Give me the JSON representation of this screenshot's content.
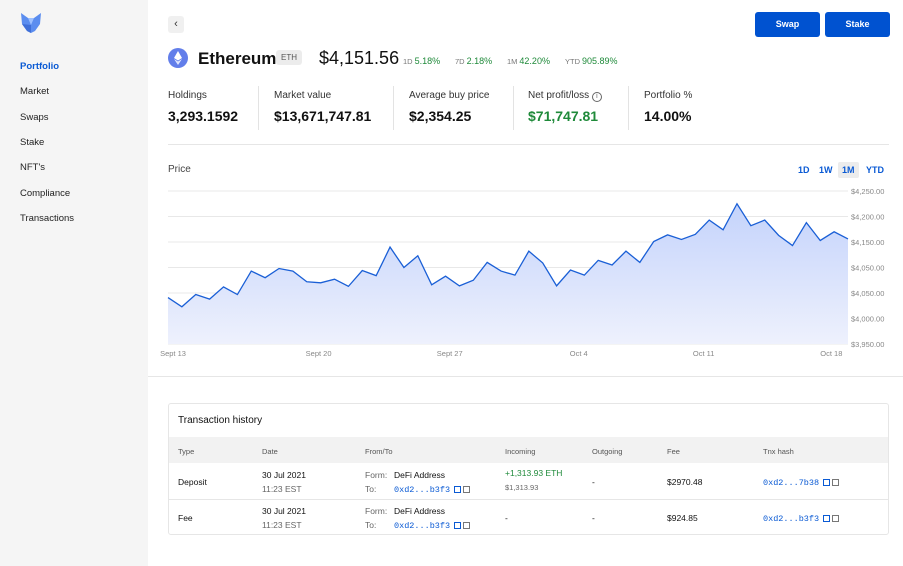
{
  "sidebar": {
    "items": [
      {
        "label": "Portfolio",
        "active": true
      },
      {
        "label": "Market"
      },
      {
        "label": "Swaps"
      },
      {
        "label": "Stake"
      },
      {
        "label": "NFT's"
      },
      {
        "label": "Compliance"
      },
      {
        "label": "Transactions"
      }
    ]
  },
  "header": {
    "back_icon": "‹",
    "swap": "Swap",
    "stake": "Stake"
  },
  "asset": {
    "name": "Ethereum",
    "ticker": "ETH",
    "price": "$4,151.56",
    "changes": [
      {
        "period": "1D",
        "value": "5.18%"
      },
      {
        "period": "7D",
        "value": "2.18%"
      },
      {
        "period": "1M",
        "value": "42.20%"
      },
      {
        "period": "YTD",
        "value": "905.89%"
      }
    ]
  },
  "stats": [
    {
      "label": "Holdings",
      "value": "3,293.1592"
    },
    {
      "label": "Market value",
      "value": "$13,671,747.81"
    },
    {
      "label": "Average buy price",
      "value": "$2,354.25"
    },
    {
      "label": "Net profit/loss",
      "value": "$71,747.81"
    },
    {
      "label": "Portfolio %",
      "value": "14.00%"
    }
  ],
  "colors": {
    "accent": "#0052d0",
    "positive": "#1f8a3a",
    "line": "#1a5fd6"
  },
  "chart_data": {
    "type": "area",
    "title": "Price",
    "ranges": [
      "1D",
      "1W",
      "1M",
      "YTD"
    ],
    "selected_range": "1M",
    "y_ticks": [
      "$4,250.00",
      "$4,200.00",
      "$4,150.00",
      "$4,050.00",
      "$4,050.00",
      "$4,000.00",
      "$3,950.00"
    ],
    "ylim": [
      3950,
      4250
    ],
    "x_labels": [
      {
        "label": "Sept 13",
        "at_index": 0
      },
      {
        "label": "Sept 20",
        "at_index": 10.85
      },
      {
        "label": "Sept 27",
        "at_index": 20.3
      },
      {
        "label": "Oct 4",
        "at_index": 29.6
      },
      {
        "label": "Oct 11",
        "at_index": 38.6
      },
      {
        "label": "Oct 18",
        "at_index": 47.8
      }
    ],
    "values": [
      4041,
      4023,
      4047,
      4038,
      4062,
      4047,
      4093,
      4080,
      4098,
      4093,
      4072,
      4070,
      4077,
      4063,
      4094,
      4084,
      4140,
      4100,
      4123,
      4066,
      4083,
      4064,
      4075,
      4110,
      4093,
      4085,
      4132,
      4109,
      4064,
      4095,
      4085,
      4114,
      4105,
      4132,
      4110,
      4151,
      4164,
      4155,
      4165,
      4193,
      4174,
      4225,
      4182,
      4193,
      4163,
      4143,
      4188,
      4153,
      4170,
      4156
    ]
  },
  "transactions": {
    "title": "Transaction history",
    "columns": [
      "Type",
      "Date",
      "From/To",
      "Incoming",
      "Outgoing",
      "Fee",
      "Tnx hash"
    ],
    "rows": [
      {
        "type": "Deposit",
        "date": "30 Jul 2021",
        "time": "11:23 EST",
        "from_label": "Form:",
        "from": "DeFi Address",
        "to_label": "To:",
        "to": "0xd2...b3f3",
        "incoming": "+1,313.93 ETH",
        "incoming_usd": "$1,313.93",
        "outgoing": "-",
        "fee": "$2970.48",
        "hash": "0xd2...7b38"
      },
      {
        "type": "Fee",
        "date": "30 Jul 2021",
        "time": "11:23 EST",
        "from_label": "Form:",
        "from": "DeFi Address",
        "to_label": "To:",
        "to": "0xd2...b3f3",
        "incoming": "-",
        "incoming_usd": "",
        "outgoing": "-",
        "fee": "$924.85",
        "hash": "0xd2...b3f3"
      }
    ]
  }
}
